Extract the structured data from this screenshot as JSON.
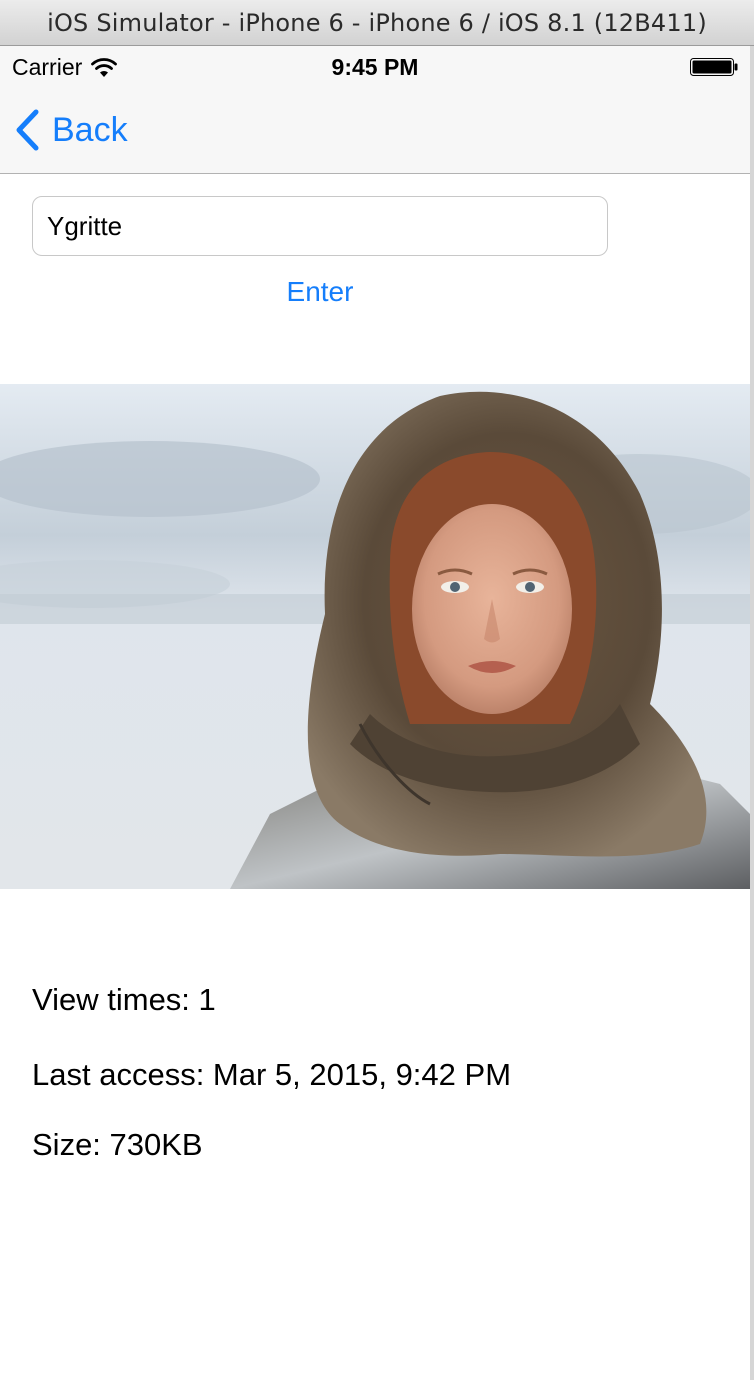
{
  "simulator": {
    "title": "iOS Simulator - iPhone 6 - iPhone 6 / iOS 8.1 (12B411)"
  },
  "status_bar": {
    "carrier": "Carrier",
    "time": "9:45 PM",
    "wifi_icon": "wifi-icon",
    "battery_icon": "battery-icon"
  },
  "nav": {
    "back_label": "Back",
    "back_icon": "chevron-left-icon",
    "accent_color": "#157efb"
  },
  "form": {
    "name_value": "Ygritte",
    "enter_label": "Enter"
  },
  "image": {
    "description_icon": "portrait-photo"
  },
  "info": {
    "view_times": "View times: 1",
    "last_access": "Last access: Mar 5, 2015, 9:42 PM",
    "size": "Size: 730KB"
  }
}
